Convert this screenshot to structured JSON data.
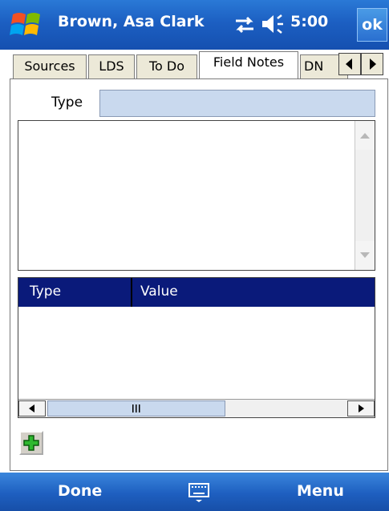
{
  "titlebar": {
    "title": "Brown, Asa Clark",
    "clock": "5:00",
    "ok_label": "ok"
  },
  "tabs": [
    {
      "label": "Sources",
      "active": false
    },
    {
      "label": "LDS",
      "active": false
    },
    {
      "label": "To Do",
      "active": false
    },
    {
      "label": "Field Notes",
      "active": true
    },
    {
      "label": "DN",
      "active": false
    }
  ],
  "form": {
    "type_label": "Type",
    "type_value": "",
    "notes_value": ""
  },
  "list": {
    "columns": [
      "Type",
      "Value"
    ],
    "rows": []
  },
  "menubar": {
    "left_label": "Done",
    "right_label": "Menu"
  },
  "colors": {
    "titlebar": "#1c5fc2",
    "list_header": "#0a1a7a",
    "input_fill": "#c9d9ee"
  }
}
